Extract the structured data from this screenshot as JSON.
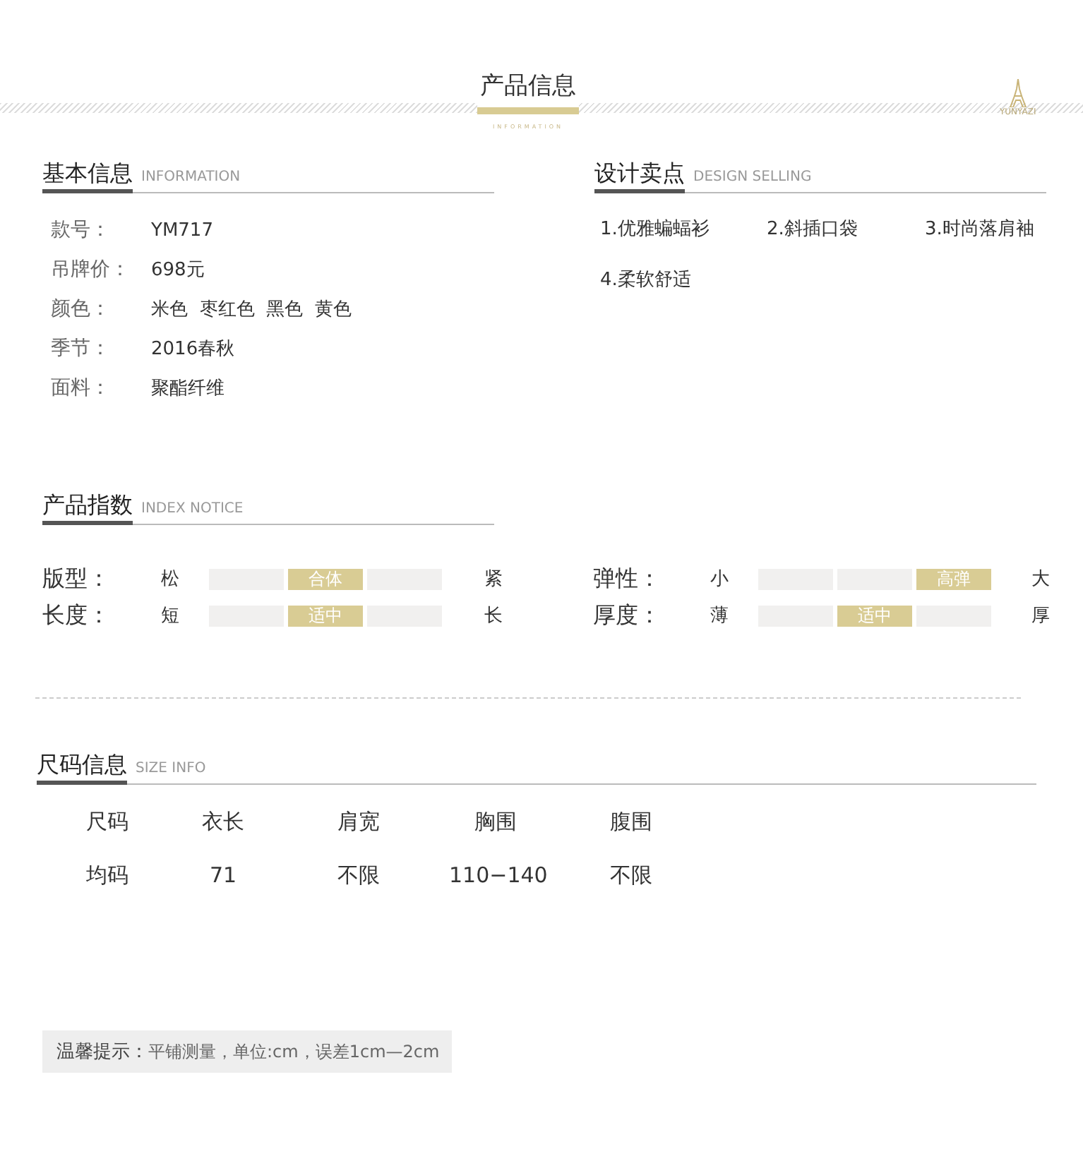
{
  "header": {
    "title": "产品信息",
    "subtitle": "INFORMATION",
    "logo": "YUNYAZI"
  },
  "basic_info": {
    "title": "基本信息",
    "subtitle": "INFORMATION",
    "rows": [
      {
        "label": "款号：",
        "value": "YM717"
      },
      {
        "label": "吊牌价：",
        "value": "698元"
      },
      {
        "label": "颜色：",
        "value": "米色  枣红色  黑色  黄色"
      },
      {
        "label": "季节：",
        "value": "2016春秋"
      },
      {
        "label": "面料：",
        "value": "聚酯纤维"
      }
    ]
  },
  "design_selling": {
    "title": "设计卖点",
    "subtitle": "DESIGN SELLING",
    "items": [
      "1.优雅蝙蝠衫",
      "2.斜插口袋",
      "3.时尚落肩袖",
      "4.柔软舒适"
    ]
  },
  "product_index": {
    "title": "产品指数",
    "subtitle": "INDEX NOTICE",
    "scales": [
      {
        "label": "版型：",
        "low": "松",
        "high": "紧",
        "cells": [
          {
            "selected": false
          },
          {
            "selected": true,
            "text": "合体"
          },
          {
            "selected": false
          }
        ]
      },
      {
        "label": "弹性：",
        "low": "小",
        "high": "大",
        "cells": [
          {
            "selected": false
          },
          {
            "selected": false
          },
          {
            "selected": true,
            "text": "高弹"
          }
        ]
      },
      {
        "label": "长度：",
        "low": "短",
        "high": "长",
        "cells": [
          {
            "selected": false
          },
          {
            "selected": true,
            "text": "适中"
          },
          {
            "selected": false
          }
        ]
      },
      {
        "label": "厚度：",
        "low": "薄",
        "high": "厚",
        "cells": [
          {
            "selected": false
          },
          {
            "selected": true,
            "text": "适中"
          },
          {
            "selected": false
          }
        ]
      }
    ]
  },
  "size_info": {
    "title": "尺码信息",
    "subtitle": "SIZE INFO",
    "columns": [
      "尺码",
      "衣长",
      "肩宽",
      "胸围",
      "腹围"
    ],
    "rows": [
      [
        "均码",
        "71",
        "不限",
        "110−140",
        "不限"
      ]
    ]
  },
  "hint": {
    "label": "温馨提示：",
    "text": "平铺测量，单位:cm，误差1cm—2cm"
  }
}
